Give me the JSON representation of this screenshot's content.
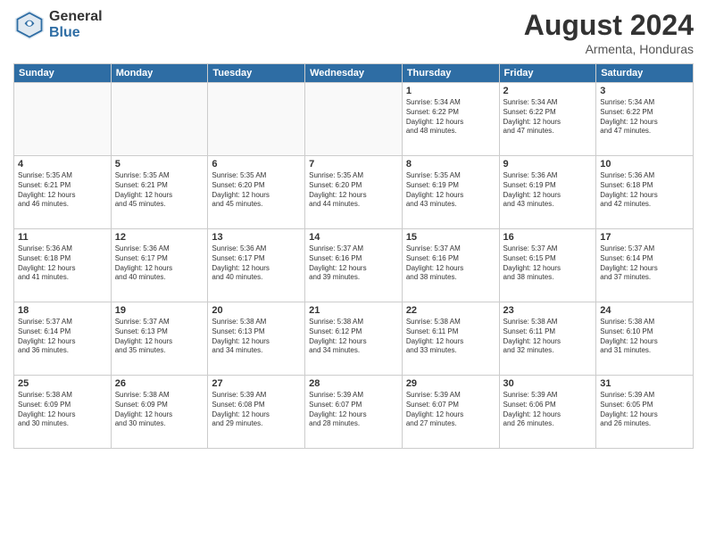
{
  "header": {
    "logo_general": "General",
    "logo_blue": "Blue",
    "month_title": "August 2024",
    "location": "Armenta, Honduras"
  },
  "weekdays": [
    "Sunday",
    "Monday",
    "Tuesday",
    "Wednesday",
    "Thursday",
    "Friday",
    "Saturday"
  ],
  "weeks": [
    [
      {
        "day": "",
        "info": ""
      },
      {
        "day": "",
        "info": ""
      },
      {
        "day": "",
        "info": ""
      },
      {
        "day": "",
        "info": ""
      },
      {
        "day": "1",
        "info": "Sunrise: 5:34 AM\nSunset: 6:22 PM\nDaylight: 12 hours\nand 48 minutes."
      },
      {
        "day": "2",
        "info": "Sunrise: 5:34 AM\nSunset: 6:22 PM\nDaylight: 12 hours\nand 47 minutes."
      },
      {
        "day": "3",
        "info": "Sunrise: 5:34 AM\nSunset: 6:22 PM\nDaylight: 12 hours\nand 47 minutes."
      }
    ],
    [
      {
        "day": "4",
        "info": "Sunrise: 5:35 AM\nSunset: 6:21 PM\nDaylight: 12 hours\nand 46 minutes."
      },
      {
        "day": "5",
        "info": "Sunrise: 5:35 AM\nSunset: 6:21 PM\nDaylight: 12 hours\nand 45 minutes."
      },
      {
        "day": "6",
        "info": "Sunrise: 5:35 AM\nSunset: 6:20 PM\nDaylight: 12 hours\nand 45 minutes."
      },
      {
        "day": "7",
        "info": "Sunrise: 5:35 AM\nSunset: 6:20 PM\nDaylight: 12 hours\nand 44 minutes."
      },
      {
        "day": "8",
        "info": "Sunrise: 5:35 AM\nSunset: 6:19 PM\nDaylight: 12 hours\nand 43 minutes."
      },
      {
        "day": "9",
        "info": "Sunrise: 5:36 AM\nSunset: 6:19 PM\nDaylight: 12 hours\nand 43 minutes."
      },
      {
        "day": "10",
        "info": "Sunrise: 5:36 AM\nSunset: 6:18 PM\nDaylight: 12 hours\nand 42 minutes."
      }
    ],
    [
      {
        "day": "11",
        "info": "Sunrise: 5:36 AM\nSunset: 6:18 PM\nDaylight: 12 hours\nand 41 minutes."
      },
      {
        "day": "12",
        "info": "Sunrise: 5:36 AM\nSunset: 6:17 PM\nDaylight: 12 hours\nand 40 minutes."
      },
      {
        "day": "13",
        "info": "Sunrise: 5:36 AM\nSunset: 6:17 PM\nDaylight: 12 hours\nand 40 minutes."
      },
      {
        "day": "14",
        "info": "Sunrise: 5:37 AM\nSunset: 6:16 PM\nDaylight: 12 hours\nand 39 minutes."
      },
      {
        "day": "15",
        "info": "Sunrise: 5:37 AM\nSunset: 6:16 PM\nDaylight: 12 hours\nand 38 minutes."
      },
      {
        "day": "16",
        "info": "Sunrise: 5:37 AM\nSunset: 6:15 PM\nDaylight: 12 hours\nand 38 minutes."
      },
      {
        "day": "17",
        "info": "Sunrise: 5:37 AM\nSunset: 6:14 PM\nDaylight: 12 hours\nand 37 minutes."
      }
    ],
    [
      {
        "day": "18",
        "info": "Sunrise: 5:37 AM\nSunset: 6:14 PM\nDaylight: 12 hours\nand 36 minutes."
      },
      {
        "day": "19",
        "info": "Sunrise: 5:37 AM\nSunset: 6:13 PM\nDaylight: 12 hours\nand 35 minutes."
      },
      {
        "day": "20",
        "info": "Sunrise: 5:38 AM\nSunset: 6:13 PM\nDaylight: 12 hours\nand 34 minutes."
      },
      {
        "day": "21",
        "info": "Sunrise: 5:38 AM\nSunset: 6:12 PM\nDaylight: 12 hours\nand 34 minutes."
      },
      {
        "day": "22",
        "info": "Sunrise: 5:38 AM\nSunset: 6:11 PM\nDaylight: 12 hours\nand 33 minutes."
      },
      {
        "day": "23",
        "info": "Sunrise: 5:38 AM\nSunset: 6:11 PM\nDaylight: 12 hours\nand 32 minutes."
      },
      {
        "day": "24",
        "info": "Sunrise: 5:38 AM\nSunset: 6:10 PM\nDaylight: 12 hours\nand 31 minutes."
      }
    ],
    [
      {
        "day": "25",
        "info": "Sunrise: 5:38 AM\nSunset: 6:09 PM\nDaylight: 12 hours\nand 30 minutes."
      },
      {
        "day": "26",
        "info": "Sunrise: 5:38 AM\nSunset: 6:09 PM\nDaylight: 12 hours\nand 30 minutes."
      },
      {
        "day": "27",
        "info": "Sunrise: 5:39 AM\nSunset: 6:08 PM\nDaylight: 12 hours\nand 29 minutes."
      },
      {
        "day": "28",
        "info": "Sunrise: 5:39 AM\nSunset: 6:07 PM\nDaylight: 12 hours\nand 28 minutes."
      },
      {
        "day": "29",
        "info": "Sunrise: 5:39 AM\nSunset: 6:07 PM\nDaylight: 12 hours\nand 27 minutes."
      },
      {
        "day": "30",
        "info": "Sunrise: 5:39 AM\nSunset: 6:06 PM\nDaylight: 12 hours\nand 26 minutes."
      },
      {
        "day": "31",
        "info": "Sunrise: 5:39 AM\nSunset: 6:05 PM\nDaylight: 12 hours\nand 26 minutes."
      }
    ]
  ]
}
